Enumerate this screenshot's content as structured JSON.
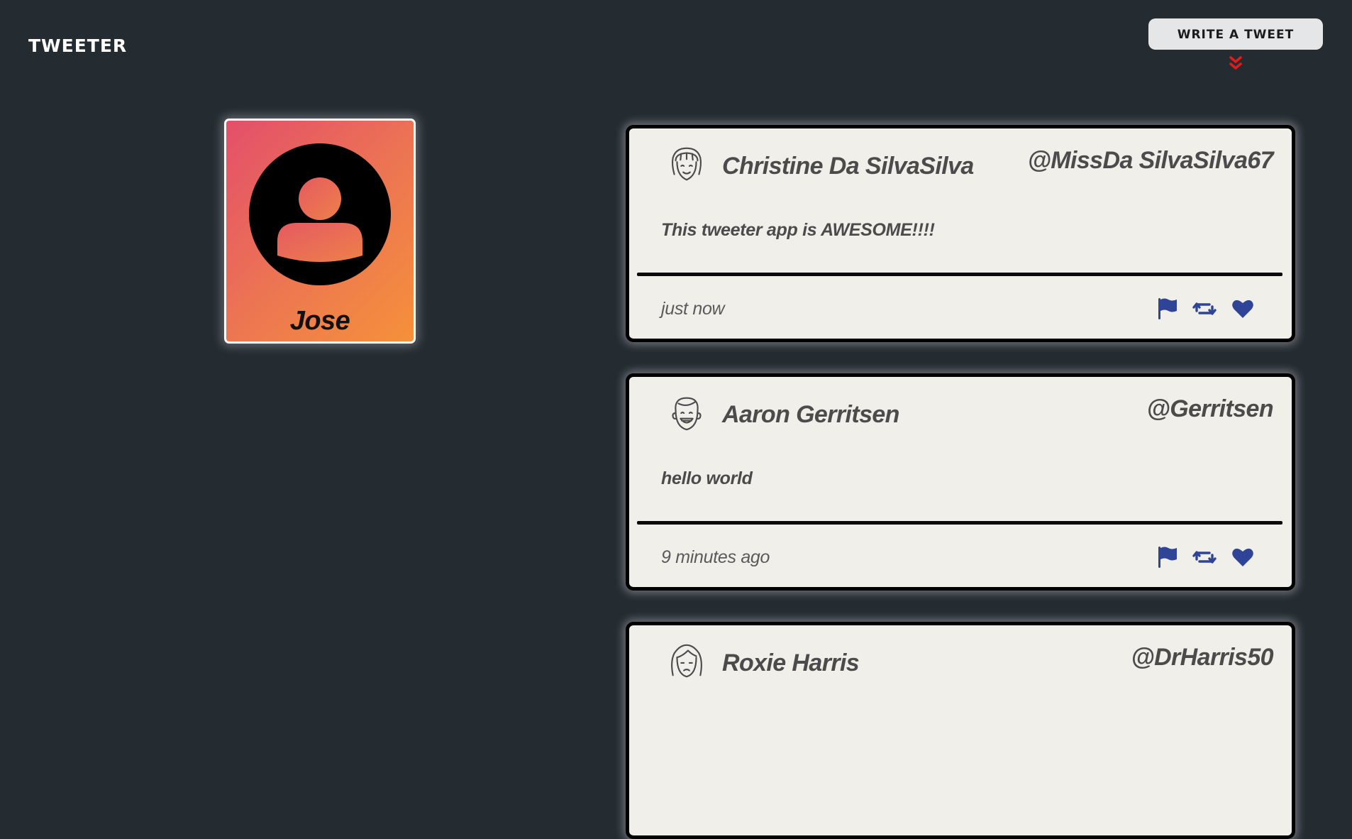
{
  "app": {
    "brand": "TWEETER",
    "write_button_label": "WRITE A TWEET",
    "accent_color": "#e21b1b",
    "icon_color": "#2f4496"
  },
  "profile": {
    "name": "Jose",
    "avatar_icon": "user-circle-icon"
  },
  "tweets": [
    {
      "name": "Christine Da SilvaSilva",
      "handle": "@MissDa SilvaSilva67",
      "content": "This tweeter app is AWESOME!!!!",
      "time": "just now",
      "avatar_icon": "female-face-bangs-icon"
    },
    {
      "name": "Aaron Gerritsen",
      "handle": "@Gerritsen",
      "content": "hello world",
      "time": "9 minutes ago",
      "avatar_icon": "male-face-smiling-icon"
    },
    {
      "name": "Roxie Harris",
      "handle": "@DrHarris50",
      "content": "",
      "time": "",
      "avatar_icon": "female-face-long-hair-icon"
    }
  ],
  "actions": [
    "flag-icon",
    "retweet-icon",
    "heart-icon"
  ]
}
